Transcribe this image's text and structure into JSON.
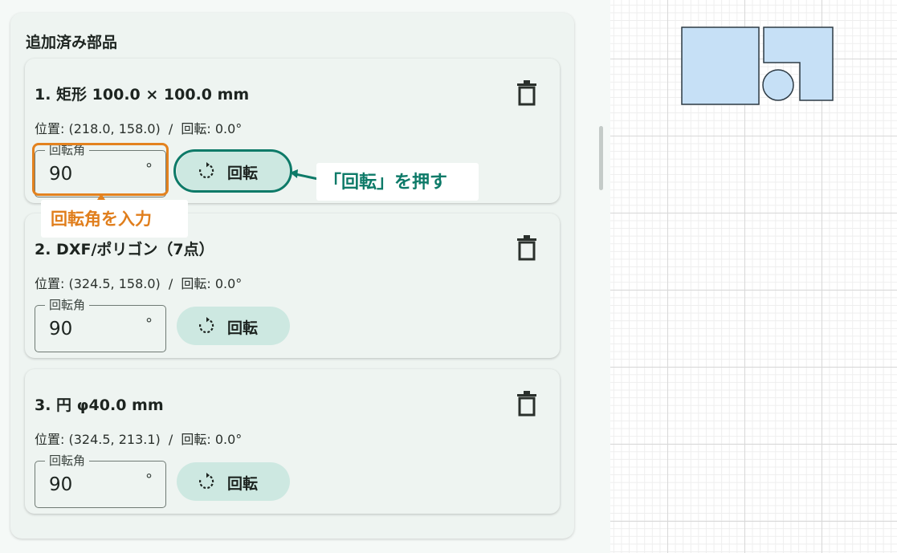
{
  "panel": {
    "title": "追加済み部品"
  },
  "common": {
    "position_label": "位置:",
    "rotation_label": "回転:",
    "separator": "/",
    "angle_label": "回転角",
    "angle_unit": "°",
    "rotate_button_label": "回転"
  },
  "parts": [
    {
      "name": "1. 矩形 100.0 × 100.0 mm",
      "position": "(218.0, 158.0)",
      "rotation": "0.0°",
      "angle_value": "90"
    },
    {
      "name": "2. DXF/ポリゴン（7点）",
      "position": "(324.5, 158.0)",
      "rotation": "0.0°",
      "angle_value": "90"
    },
    {
      "name": "3. 円 φ40.0 mm",
      "position": "(324.5, 213.1)",
      "rotation": "0.0°",
      "angle_value": "90"
    }
  ],
  "annotations": {
    "enter_angle": "回転角を入力",
    "press_rotate": "「回転」を押す"
  },
  "colors": {
    "accent_orange": "#e3821f",
    "accent_teal": "#0d7a68",
    "button_bg": "#cde8e1",
    "shape_fill": "#c6e0f6",
    "shape_stroke": "#2d3a44"
  },
  "icons": {
    "delete": "trash-icon",
    "rotate": "rotate-icon"
  }
}
